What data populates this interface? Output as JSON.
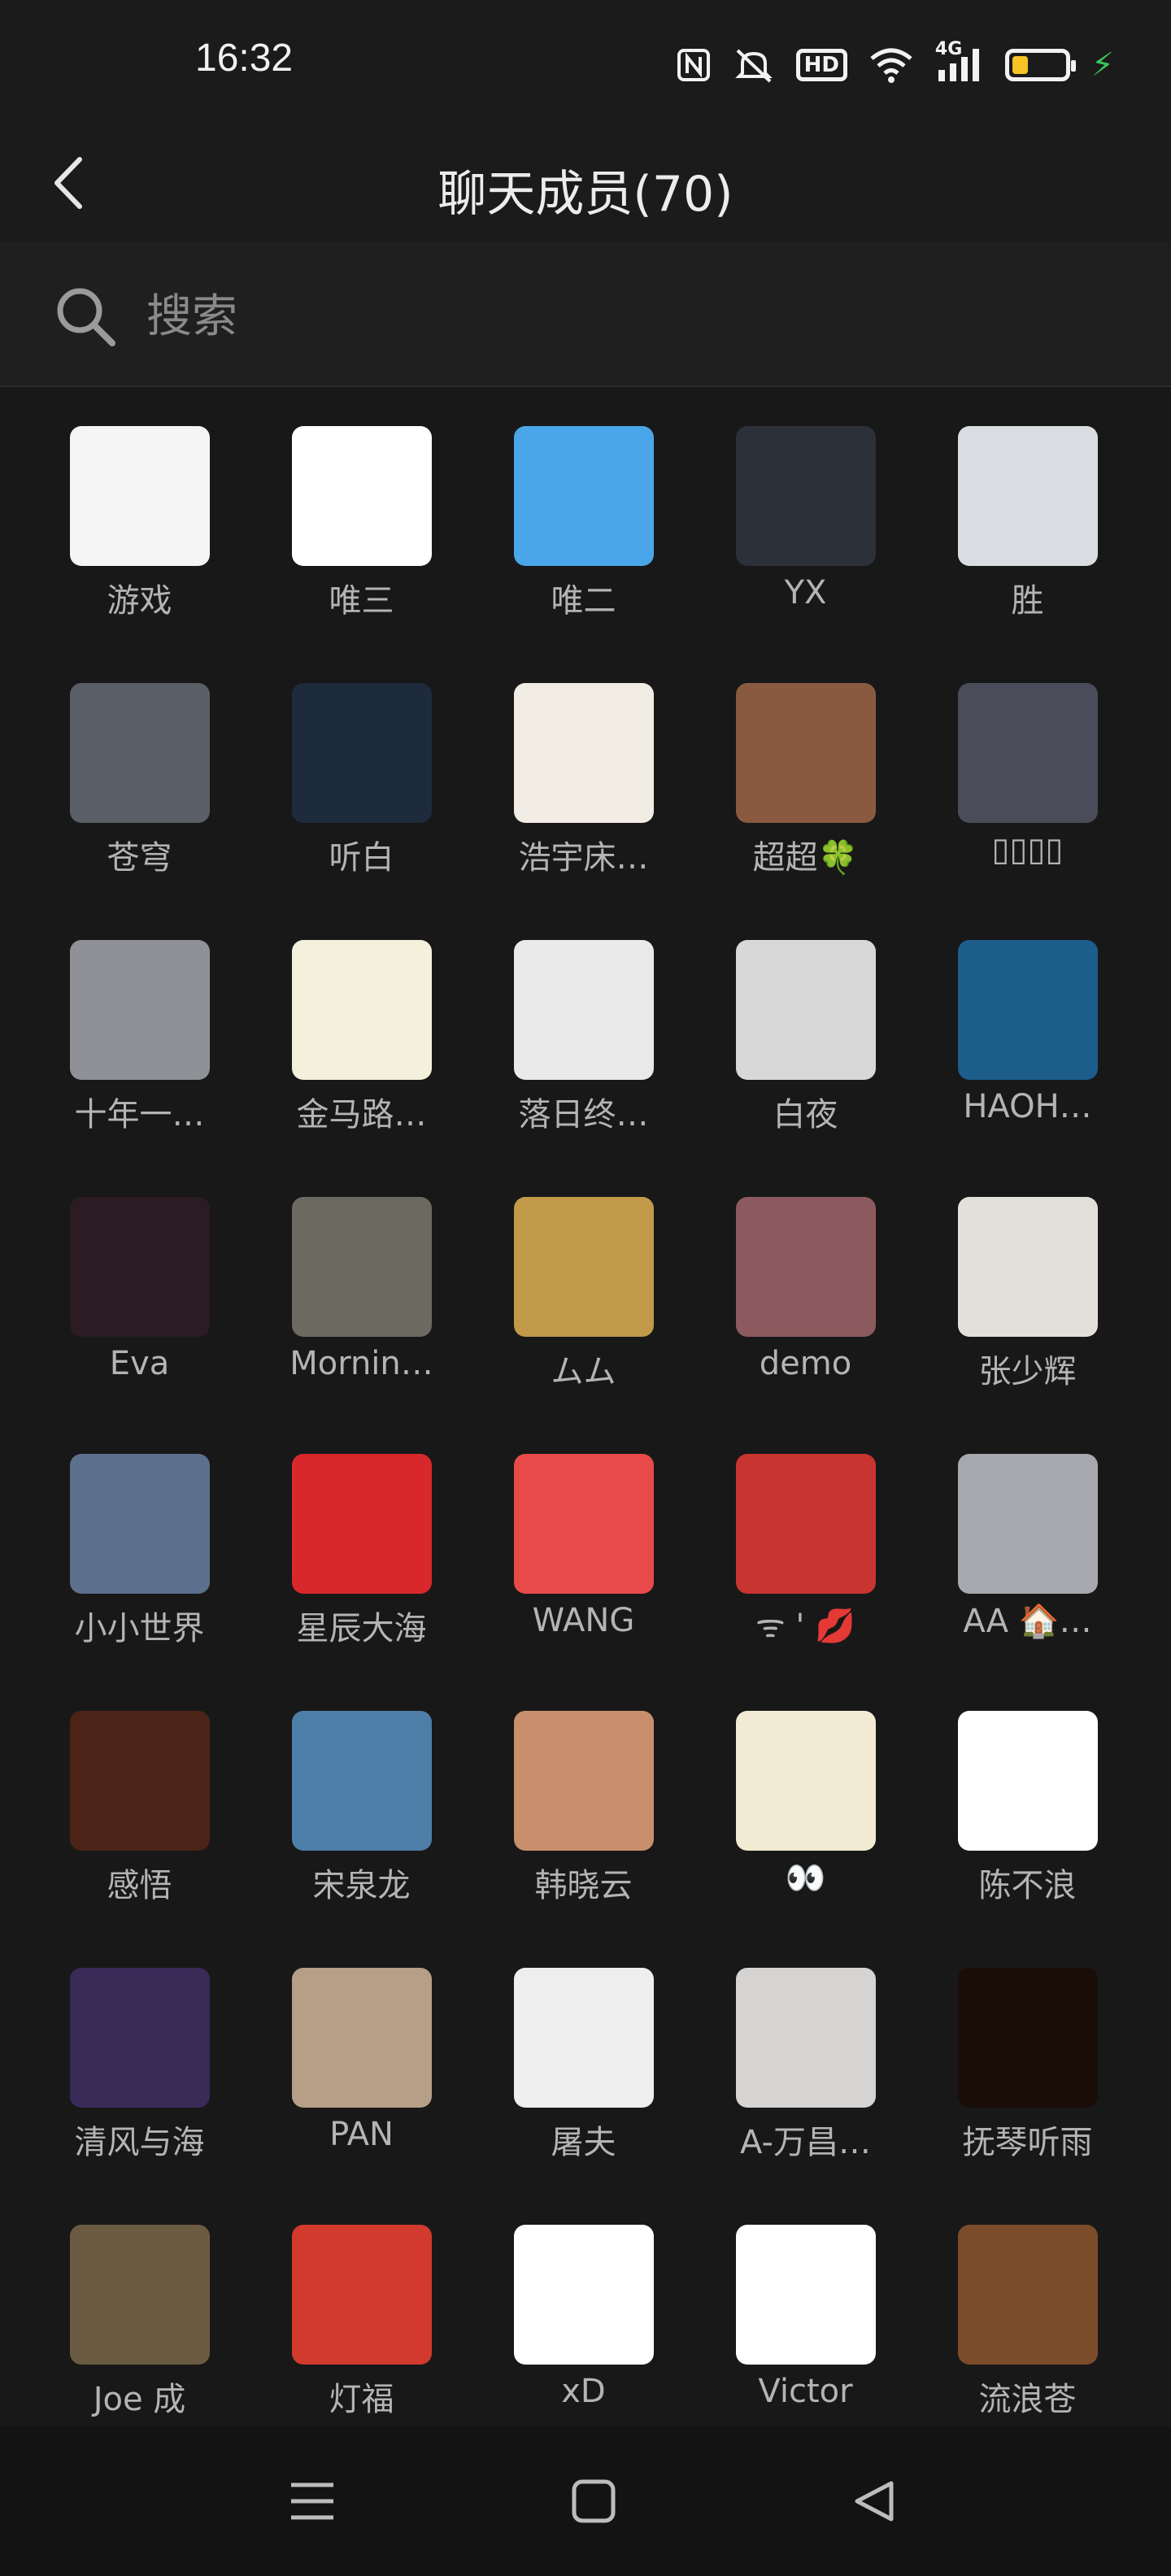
{
  "status_bar": {
    "time": "16:32",
    "icons": [
      "nfc-icon",
      "mute-icon",
      "hd-icon",
      "wifi-icon",
      "signal-4g-icon",
      "battery-icon",
      "charging-icon"
    ],
    "hd_label": "HD",
    "network_label": "4G",
    "battery_level_percent": 30
  },
  "header": {
    "title": "聊天成员(70)",
    "back_icon": "chevron-left-icon"
  },
  "search": {
    "placeholder": "搜索",
    "icon": "search-icon"
  },
  "members": [
    {
      "name": "游戏",
      "avatar_color": "#f5f5f5"
    },
    {
      "name": "唯三",
      "avatar_color": "#ffffff"
    },
    {
      "name": "唯二",
      "avatar_color": "#4aa6e8"
    },
    {
      "name": "YX",
      "avatar_color": "#2c3038"
    },
    {
      "name": "胜",
      "avatar_color": "#d9dde2"
    },
    {
      "name": "苍穹",
      "avatar_color": "#5a5e66"
    },
    {
      "name": "听白",
      "avatar_color": "#1e2b3c"
    },
    {
      "name": "浩宇床…",
      "avatar_color": "#f1ece4"
    },
    {
      "name": "超超🍀",
      "avatar_color": "#8a5a40"
    },
    {
      "name": "▯▯▯▯",
      "avatar_color": "#4a4c5a"
    },
    {
      "name": "十年一…",
      "avatar_color": "#8f9196"
    },
    {
      "name": "金马路…",
      "avatar_color": "#f3f1dc"
    },
    {
      "name": "落日终…",
      "avatar_color": "#e9e9e9"
    },
    {
      "name": "白夜",
      "avatar_color": "#d8d8d8"
    },
    {
      "name": "HAOH…",
      "avatar_color": "#1c5d8c"
    },
    {
      "name": "Eva",
      "avatar_color": "#2b1b22"
    },
    {
      "name": "Mornin…",
      "avatar_color": "#6c6a60"
    },
    {
      "name": "ムム",
      "avatar_color": "#c19a4a"
    },
    {
      "name": "demo",
      "avatar_color": "#8c5a5e"
    },
    {
      "name": "张少辉",
      "avatar_color": "#e3dfda"
    },
    {
      "name": "小小世界",
      "avatar_color": "#5c6f8c"
    },
    {
      "name": "星辰大海",
      "avatar_color": "#d8282c"
    },
    {
      "name": "WANG",
      "avatar_color": "#e84a4a"
    },
    {
      "name": "ᯤ ' 💋",
      "avatar_color": "#c8342f"
    },
    {
      "name": "AA 🏠…",
      "avatar_color": "#a7a9ae"
    },
    {
      "name": "感悟",
      "avatar_color": "#4b2417"
    },
    {
      "name": "宋泉龙",
      "avatar_color": "#4d7ea8"
    },
    {
      "name": "韩晓云",
      "avatar_color": "#c98f6c"
    },
    {
      "name": "👀",
      "avatar_color": "#f2ead2"
    },
    {
      "name": "陈不浪",
      "avatar_color": "#ffffff"
    },
    {
      "name": "清风与海",
      "avatar_color": "#3a2a58"
    },
    {
      "name": "PAN",
      "avatar_color": "#b79e86"
    },
    {
      "name": "屠夫",
      "avatar_color": "#eeeeee"
    },
    {
      "name": "A-万昌…",
      "avatar_color": "#d6d4d2"
    },
    {
      "name": "抚琴听雨",
      "avatar_color": "#1a0c06"
    },
    {
      "name": "Joe 成",
      "avatar_color": "#6b5b42"
    },
    {
      "name": "灯福",
      "avatar_color": "#d23a2e"
    },
    {
      "name": "xD",
      "avatar_color": "#ffffff"
    },
    {
      "name": "Victor",
      "avatar_color": "#ffffff"
    },
    {
      "name": "流浪苍",
      "avatar_color": "#7b4b2a"
    }
  ],
  "bottom_nav": {
    "buttons": [
      "menu-icon",
      "home-icon",
      "back-triangle-icon"
    ]
  }
}
